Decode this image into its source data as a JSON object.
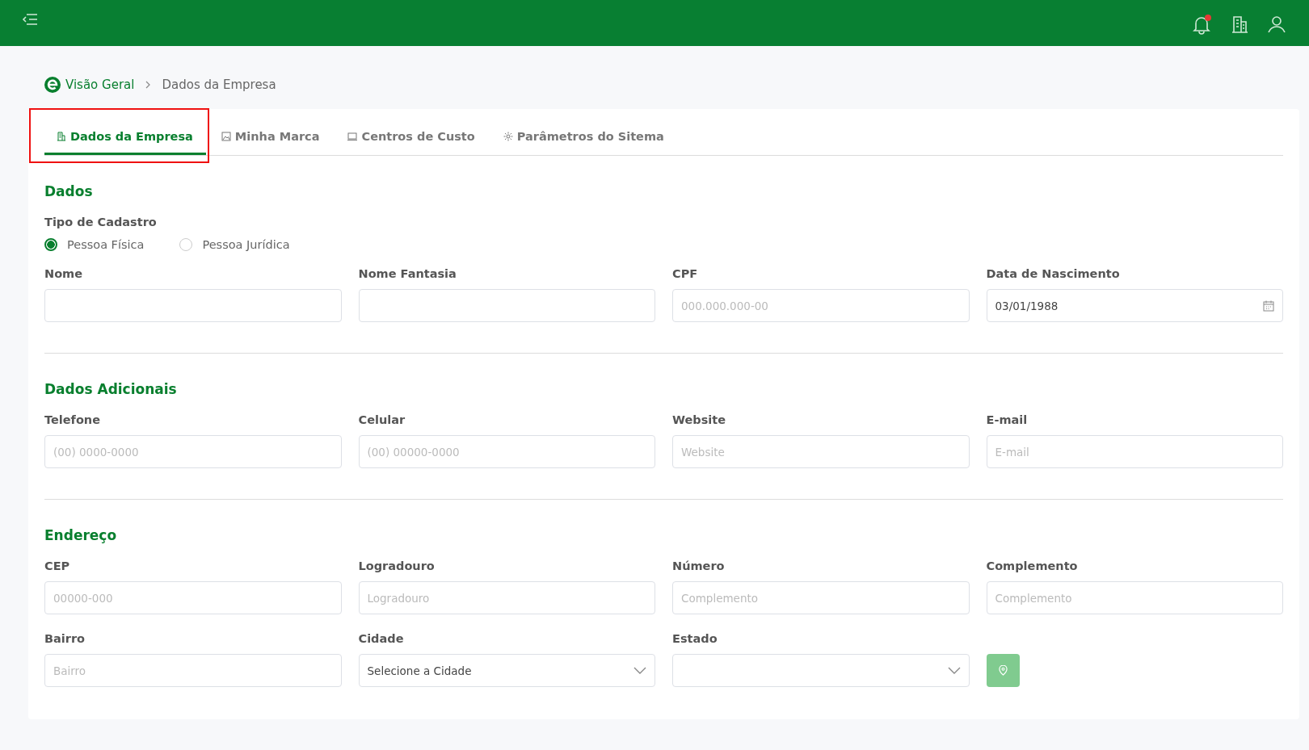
{
  "topbar": {
    "notification_dot": true
  },
  "breadcrumb": {
    "home": "Visão Geral",
    "current": "Dados da Empresa"
  },
  "tabs": [
    {
      "label": "Dados da Empresa",
      "selected": true,
      "highlighted": true
    },
    {
      "label": "Minha Marca",
      "selected": false,
      "highlighted": false
    },
    {
      "label": "Centros de Custo",
      "selected": false,
      "highlighted": false
    },
    {
      "label": "Parâmetros do Sitema",
      "selected": false,
      "highlighted": false
    }
  ],
  "sections": [
    {
      "title": "Dados",
      "radio_group": {
        "label": "Tipo de Cadastro",
        "options": [
          {
            "label": "Pessoa Física",
            "selected": true
          },
          {
            "label": "Pessoa Jurídica",
            "selected": false
          }
        ]
      },
      "fields": [
        {
          "kind": "text",
          "label": "Nome"
        },
        {
          "kind": "text",
          "label": "Nome Fantasia"
        },
        {
          "kind": "text",
          "label": "CPF",
          "placeholder": "000.000.000-00"
        },
        {
          "kind": "date",
          "label": "Data de Nascimento",
          "value": "03/01/1988"
        }
      ]
    },
    {
      "title": "Dados Adicionais",
      "fields": [
        {
          "kind": "text",
          "label": "Telefone",
          "placeholder": "(00) 0000-0000"
        },
        {
          "kind": "text",
          "label": "Celular",
          "placeholder": "(00) 00000-0000"
        },
        {
          "kind": "text",
          "label": "Website",
          "placeholder": "Website"
        },
        {
          "kind": "text",
          "label": "E-mail",
          "placeholder": "E-mail"
        }
      ]
    },
    {
      "title": "Endereço",
      "fields": [
        {
          "kind": "text",
          "label": "CEP",
          "placeholder": "00000-000"
        },
        {
          "kind": "text",
          "label": "Logradouro",
          "placeholder": "Logradouro"
        },
        {
          "kind": "text",
          "label": "Número",
          "placeholder": "Complemento"
        },
        {
          "kind": "text",
          "label": "Complemento",
          "placeholder": "Complemento"
        },
        {
          "kind": "text",
          "label": "Bairro",
          "placeholder": "Bairro"
        },
        {
          "kind": "select",
          "label": "Cidade",
          "value": "Selecione a Cidade"
        },
        {
          "kind": "select",
          "label": "Estado"
        },
        {
          "kind": "map_button"
        }
      ]
    }
  ]
}
